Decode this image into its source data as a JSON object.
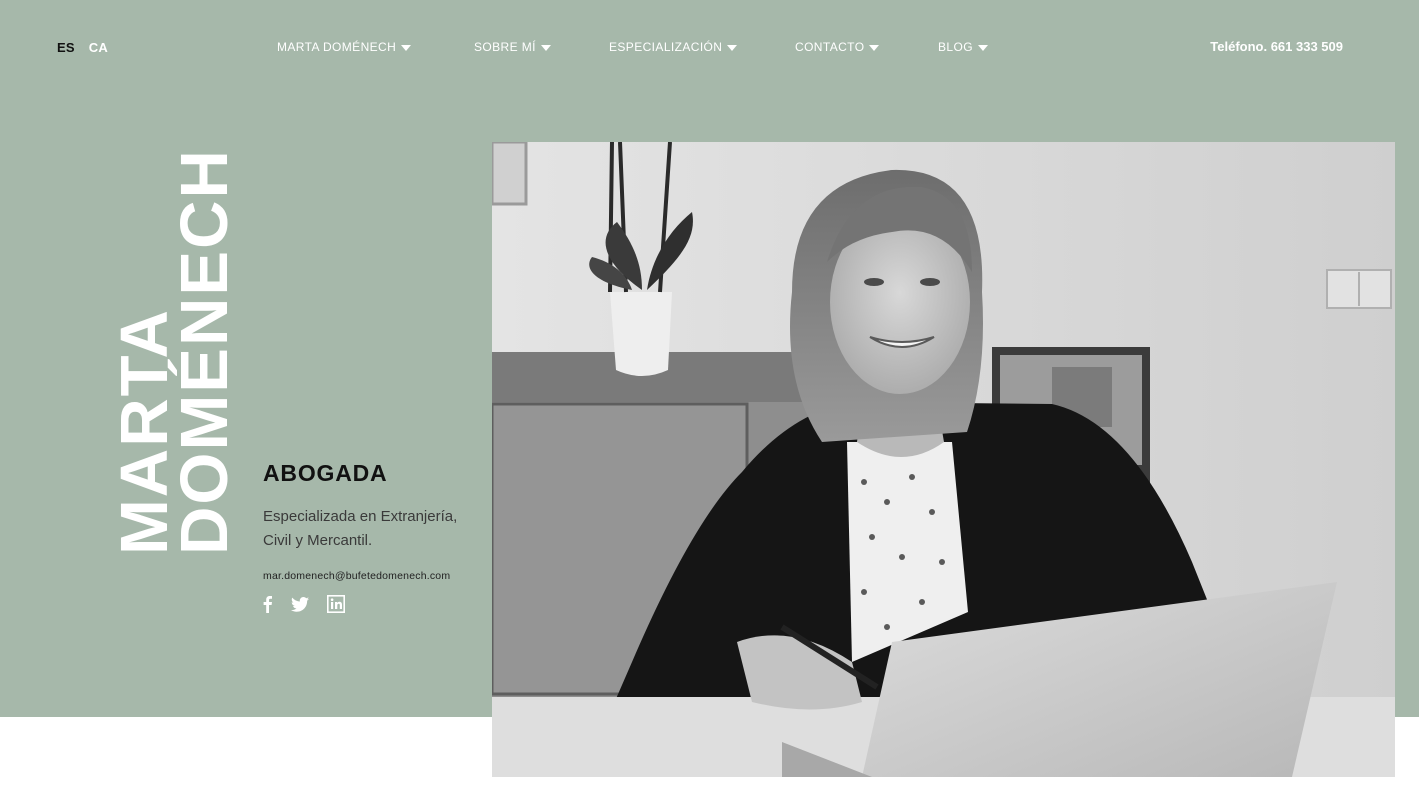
{
  "lang": {
    "active": "ES",
    "other": "CA"
  },
  "nav": {
    "items": [
      {
        "label": "MARTA DOMÉNECH"
      },
      {
        "label": "SOBRE MÍ"
      },
      {
        "label": "ESPECIALIZACIÓN"
      },
      {
        "label": "CONTACTO"
      },
      {
        "label": "BLOG"
      }
    ],
    "phone": "Teléfono. 661 333 509"
  },
  "hero": {
    "name_line1": "MARTA",
    "name_line2": "DOMÉNECH",
    "title": "ABOGADA",
    "subtitle": "Especializada en Extranjería, Civil y Mercantil.",
    "email": "mar.domenech@bufetedomenech.com",
    "socials": [
      "facebook-icon",
      "twitter-icon",
      "linkedin-icon"
    ],
    "photo_alt": "Foto de Marta Doménech en su despacho"
  },
  "colors": {
    "hero_bg": "#a6b8aa",
    "text_dark": "#111111",
    "text_light": "#ffffff"
  }
}
